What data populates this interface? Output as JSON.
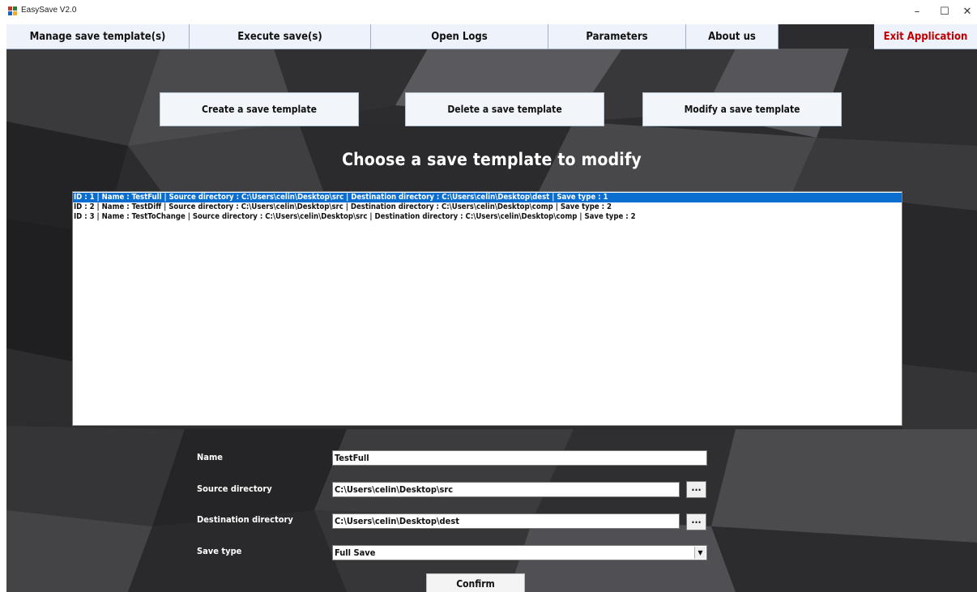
{
  "window": {
    "title": "EasySave V2.0",
    "controls": {
      "minimize": "–",
      "maximize": "☐",
      "close": "✕"
    }
  },
  "menu": {
    "items": [
      {
        "label": "Manage save template(s)"
      },
      {
        "label": "Execute save(s)"
      },
      {
        "label": "Open Logs"
      },
      {
        "label": "Parameters"
      },
      {
        "label": "About us"
      }
    ],
    "exit_label": "Exit Application",
    "exit_color": "#c00000"
  },
  "actions": {
    "create": "Create a save template",
    "delete": "Delete a save template",
    "modify": "Modify a save template"
  },
  "heading": "Choose a save template to modify",
  "templates": {
    "selected_index": 0,
    "selected_color": "#0a6ed1",
    "rows": [
      "ID : 1 | Name : TestFull | Source directory : C:\\Users\\celin\\Desktop\\src | Destination directory : C:\\Users\\celin\\Desktop\\dest | Save type : 1",
      "ID : 2 | Name : TestDiff | Source directory : C:\\Users\\celin\\Desktop\\src | Destination directory : C:\\Users\\celin\\Desktop\\comp | Save type : 2",
      "ID : 3 | Name : TestToChange | Source directory : C:\\Users\\celin\\Desktop\\src | Destination directory : C:\\Users\\celin\\Desktop\\comp | Save type : 2"
    ]
  },
  "form": {
    "name_label": "Name",
    "name_value": "TestFull",
    "source_label": "Source directory",
    "source_value": "C:\\Users\\celin\\Desktop\\src",
    "dest_label": "Destination directory",
    "dest_value": "C:\\Users\\celin\\Desktop\\dest",
    "browse_label": "...",
    "savetype_label": "Save type",
    "savetype_value": "Full Save",
    "savetype_arrow": "▼",
    "confirm_label": "Confirm"
  }
}
